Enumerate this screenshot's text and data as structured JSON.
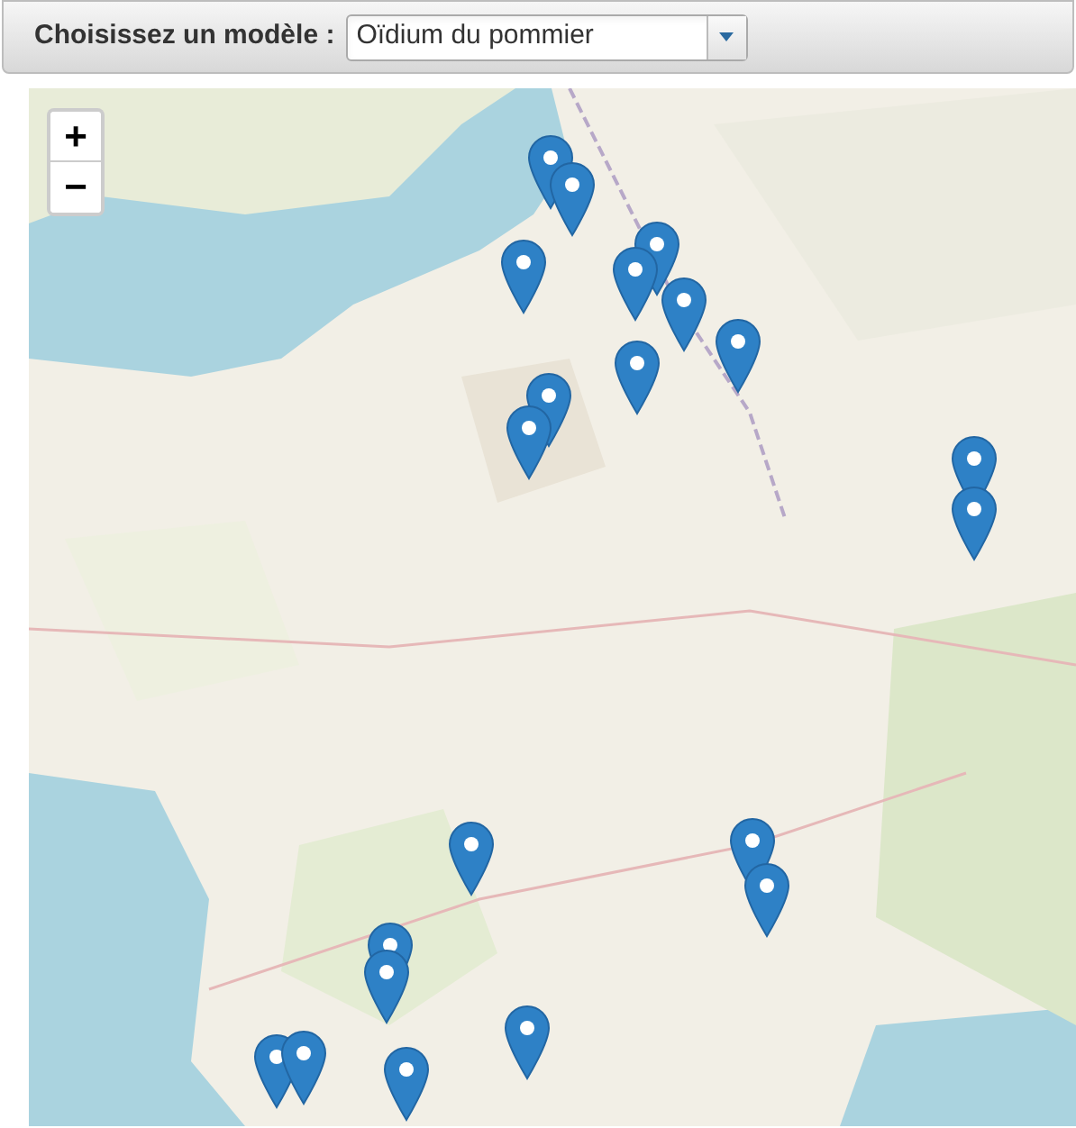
{
  "model_selector": {
    "label": "Choisissez un modèle :",
    "value": "Oïdium du pommier"
  },
  "map": {
    "zoom_controls": [
      "+",
      "−"
    ]
  }
}
